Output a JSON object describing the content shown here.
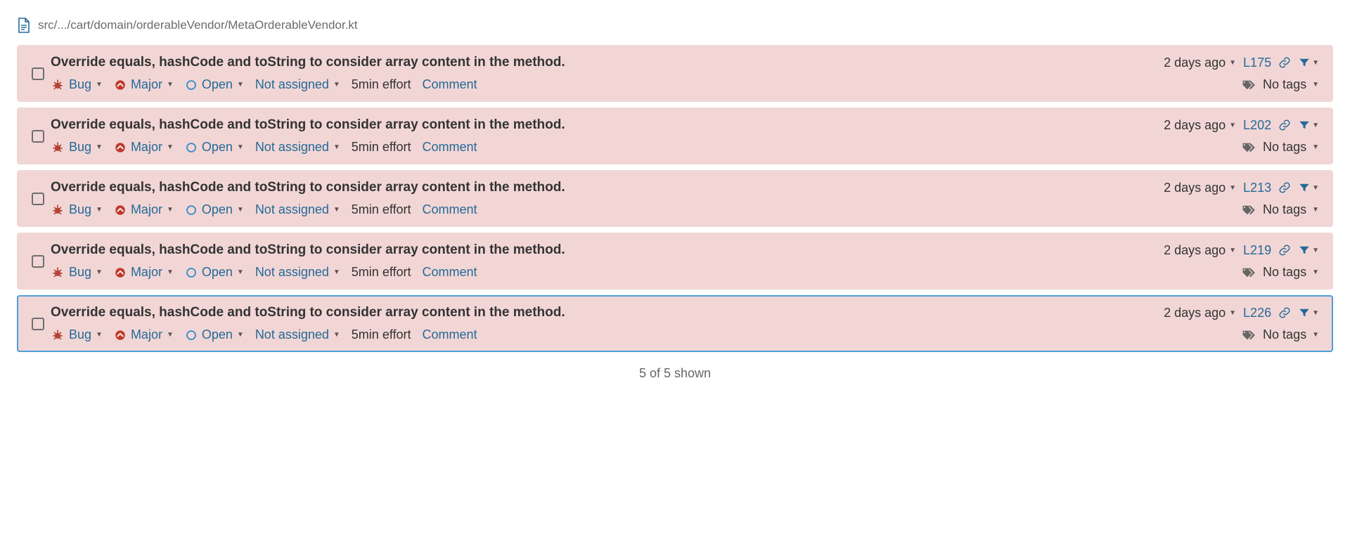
{
  "file_path": "src/.../cart/domain/orderableVendor/MetaOrderableVendor.kt",
  "labels": {
    "bug": "Bug",
    "major": "Major",
    "open": "Open",
    "not_assigned": "Not assigned",
    "comment": "Comment",
    "no_tags": "No tags"
  },
  "issues": [
    {
      "title": "Override equals, hashCode and toString to consider array content in the method.",
      "age": "2 days ago",
      "line": "L175",
      "effort": "5min effort",
      "selected": false
    },
    {
      "title": "Override equals, hashCode and toString to consider array content in the method.",
      "age": "2 days ago",
      "line": "L202",
      "effort": "5min effort",
      "selected": false
    },
    {
      "title": "Override equals, hashCode and toString to consider array content in the method.",
      "age": "2 days ago",
      "line": "L213",
      "effort": "5min effort",
      "selected": false
    },
    {
      "title": "Override equals, hashCode and toString to consider array content in the method.",
      "age": "2 days ago",
      "line": "L219",
      "effort": "5min effort",
      "selected": false
    },
    {
      "title": "Override equals, hashCode and toString to consider array content in the method.",
      "age": "2 days ago",
      "line": "L226",
      "effort": "5min effort",
      "selected": true
    }
  ],
  "footer": "5 of 5 shown"
}
